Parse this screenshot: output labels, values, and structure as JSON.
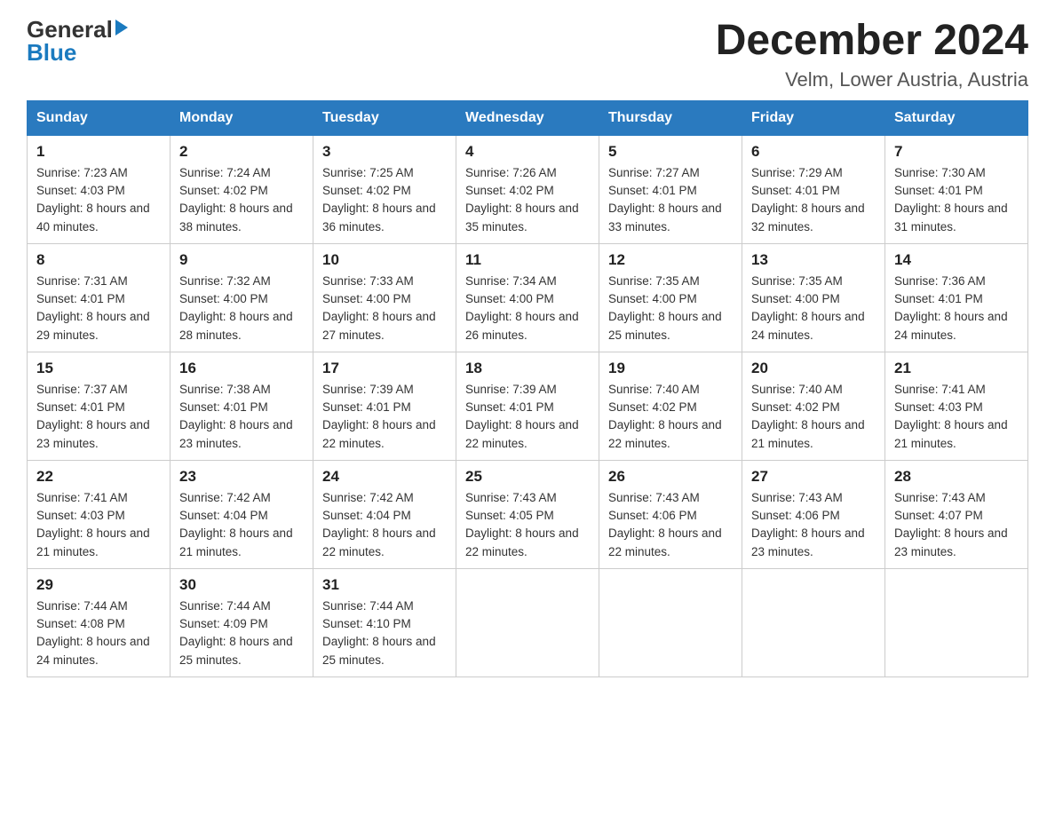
{
  "logo": {
    "general": "General",
    "blue": "Blue",
    "arrow": "▶"
  },
  "title": "December 2024",
  "location": "Velm, Lower Austria, Austria",
  "days_of_week": [
    "Sunday",
    "Monday",
    "Tuesday",
    "Wednesday",
    "Thursday",
    "Friday",
    "Saturday"
  ],
  "weeks": [
    [
      {
        "day": "1",
        "sunrise": "Sunrise: 7:23 AM",
        "sunset": "Sunset: 4:03 PM",
        "daylight": "Daylight: 8 hours and 40 minutes."
      },
      {
        "day": "2",
        "sunrise": "Sunrise: 7:24 AM",
        "sunset": "Sunset: 4:02 PM",
        "daylight": "Daylight: 8 hours and 38 minutes."
      },
      {
        "day": "3",
        "sunrise": "Sunrise: 7:25 AM",
        "sunset": "Sunset: 4:02 PM",
        "daylight": "Daylight: 8 hours and 36 minutes."
      },
      {
        "day": "4",
        "sunrise": "Sunrise: 7:26 AM",
        "sunset": "Sunset: 4:02 PM",
        "daylight": "Daylight: 8 hours and 35 minutes."
      },
      {
        "day": "5",
        "sunrise": "Sunrise: 7:27 AM",
        "sunset": "Sunset: 4:01 PM",
        "daylight": "Daylight: 8 hours and 33 minutes."
      },
      {
        "day": "6",
        "sunrise": "Sunrise: 7:29 AM",
        "sunset": "Sunset: 4:01 PM",
        "daylight": "Daylight: 8 hours and 32 minutes."
      },
      {
        "day": "7",
        "sunrise": "Sunrise: 7:30 AM",
        "sunset": "Sunset: 4:01 PM",
        "daylight": "Daylight: 8 hours and 31 minutes."
      }
    ],
    [
      {
        "day": "8",
        "sunrise": "Sunrise: 7:31 AM",
        "sunset": "Sunset: 4:01 PM",
        "daylight": "Daylight: 8 hours and 29 minutes."
      },
      {
        "day": "9",
        "sunrise": "Sunrise: 7:32 AM",
        "sunset": "Sunset: 4:00 PM",
        "daylight": "Daylight: 8 hours and 28 minutes."
      },
      {
        "day": "10",
        "sunrise": "Sunrise: 7:33 AM",
        "sunset": "Sunset: 4:00 PM",
        "daylight": "Daylight: 8 hours and 27 minutes."
      },
      {
        "day": "11",
        "sunrise": "Sunrise: 7:34 AM",
        "sunset": "Sunset: 4:00 PM",
        "daylight": "Daylight: 8 hours and 26 minutes."
      },
      {
        "day": "12",
        "sunrise": "Sunrise: 7:35 AM",
        "sunset": "Sunset: 4:00 PM",
        "daylight": "Daylight: 8 hours and 25 minutes."
      },
      {
        "day": "13",
        "sunrise": "Sunrise: 7:35 AM",
        "sunset": "Sunset: 4:00 PM",
        "daylight": "Daylight: 8 hours and 24 minutes."
      },
      {
        "day": "14",
        "sunrise": "Sunrise: 7:36 AM",
        "sunset": "Sunset: 4:01 PM",
        "daylight": "Daylight: 8 hours and 24 minutes."
      }
    ],
    [
      {
        "day": "15",
        "sunrise": "Sunrise: 7:37 AM",
        "sunset": "Sunset: 4:01 PM",
        "daylight": "Daylight: 8 hours and 23 minutes."
      },
      {
        "day": "16",
        "sunrise": "Sunrise: 7:38 AM",
        "sunset": "Sunset: 4:01 PM",
        "daylight": "Daylight: 8 hours and 23 minutes."
      },
      {
        "day": "17",
        "sunrise": "Sunrise: 7:39 AM",
        "sunset": "Sunset: 4:01 PM",
        "daylight": "Daylight: 8 hours and 22 minutes."
      },
      {
        "day": "18",
        "sunrise": "Sunrise: 7:39 AM",
        "sunset": "Sunset: 4:01 PM",
        "daylight": "Daylight: 8 hours and 22 minutes."
      },
      {
        "day": "19",
        "sunrise": "Sunrise: 7:40 AM",
        "sunset": "Sunset: 4:02 PM",
        "daylight": "Daylight: 8 hours and 22 minutes."
      },
      {
        "day": "20",
        "sunrise": "Sunrise: 7:40 AM",
        "sunset": "Sunset: 4:02 PM",
        "daylight": "Daylight: 8 hours and 21 minutes."
      },
      {
        "day": "21",
        "sunrise": "Sunrise: 7:41 AM",
        "sunset": "Sunset: 4:03 PM",
        "daylight": "Daylight: 8 hours and 21 minutes."
      }
    ],
    [
      {
        "day": "22",
        "sunrise": "Sunrise: 7:41 AM",
        "sunset": "Sunset: 4:03 PM",
        "daylight": "Daylight: 8 hours and 21 minutes."
      },
      {
        "day": "23",
        "sunrise": "Sunrise: 7:42 AM",
        "sunset": "Sunset: 4:04 PM",
        "daylight": "Daylight: 8 hours and 21 minutes."
      },
      {
        "day": "24",
        "sunrise": "Sunrise: 7:42 AM",
        "sunset": "Sunset: 4:04 PM",
        "daylight": "Daylight: 8 hours and 22 minutes."
      },
      {
        "day": "25",
        "sunrise": "Sunrise: 7:43 AM",
        "sunset": "Sunset: 4:05 PM",
        "daylight": "Daylight: 8 hours and 22 minutes."
      },
      {
        "day": "26",
        "sunrise": "Sunrise: 7:43 AM",
        "sunset": "Sunset: 4:06 PM",
        "daylight": "Daylight: 8 hours and 22 minutes."
      },
      {
        "day": "27",
        "sunrise": "Sunrise: 7:43 AM",
        "sunset": "Sunset: 4:06 PM",
        "daylight": "Daylight: 8 hours and 23 minutes."
      },
      {
        "day": "28",
        "sunrise": "Sunrise: 7:43 AM",
        "sunset": "Sunset: 4:07 PM",
        "daylight": "Daylight: 8 hours and 23 minutes."
      }
    ],
    [
      {
        "day": "29",
        "sunrise": "Sunrise: 7:44 AM",
        "sunset": "Sunset: 4:08 PM",
        "daylight": "Daylight: 8 hours and 24 minutes."
      },
      {
        "day": "30",
        "sunrise": "Sunrise: 7:44 AM",
        "sunset": "Sunset: 4:09 PM",
        "daylight": "Daylight: 8 hours and 25 minutes."
      },
      {
        "day": "31",
        "sunrise": "Sunrise: 7:44 AM",
        "sunset": "Sunset: 4:10 PM",
        "daylight": "Daylight: 8 hours and 25 minutes."
      },
      null,
      null,
      null,
      null
    ]
  ]
}
